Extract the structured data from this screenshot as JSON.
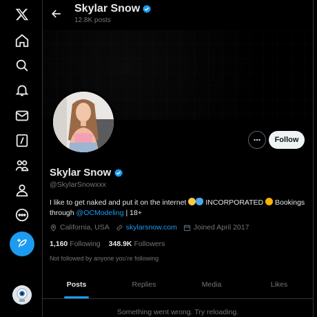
{
  "sidebar": {
    "items": [
      {
        "icon": "x-logo-icon"
      },
      {
        "icon": "home-icon"
      },
      {
        "icon": "search-icon"
      },
      {
        "icon": "bell-icon"
      },
      {
        "icon": "mail-icon"
      },
      {
        "icon": "grok-icon"
      },
      {
        "icon": "communities-icon"
      },
      {
        "icon": "profile-icon"
      },
      {
        "icon": "more-circle-icon"
      }
    ],
    "compose_icon": "feather-plus-icon"
  },
  "header": {
    "title": "Skylar Snow",
    "subtitle": "12.8K posts"
  },
  "profile": {
    "name": "Skylar Snow",
    "handle": "@SkylarSnowxxx",
    "bio_part1": "I like to get naked and put it on the internet",
    "bio_part2": "INCORPORATED",
    "bio_part3": "Bookings through",
    "bio_link": "@OCModeling",
    "bio_part4": "| 18+",
    "location": "California, USA",
    "website": "skylarsnow.com",
    "joined": "Joined April 2017",
    "following_count": "1,160",
    "following_label": "Following",
    "followers_count": "348.9K",
    "followers_label": "Followers",
    "not_followed": "Not followed by anyone you’re following",
    "follow_label": "Follow"
  },
  "tabs": [
    {
      "label": "Posts",
      "active": true
    },
    {
      "label": "Replies",
      "active": false
    },
    {
      "label": "Media",
      "active": false
    },
    {
      "label": "Likes",
      "active": false
    }
  ],
  "error_message": "Something went wrong. Try reloading.",
  "colors": {
    "accent": "#1d9bf0",
    "background": "#000000",
    "text": "#e7e9ea",
    "muted": "#71767b"
  }
}
